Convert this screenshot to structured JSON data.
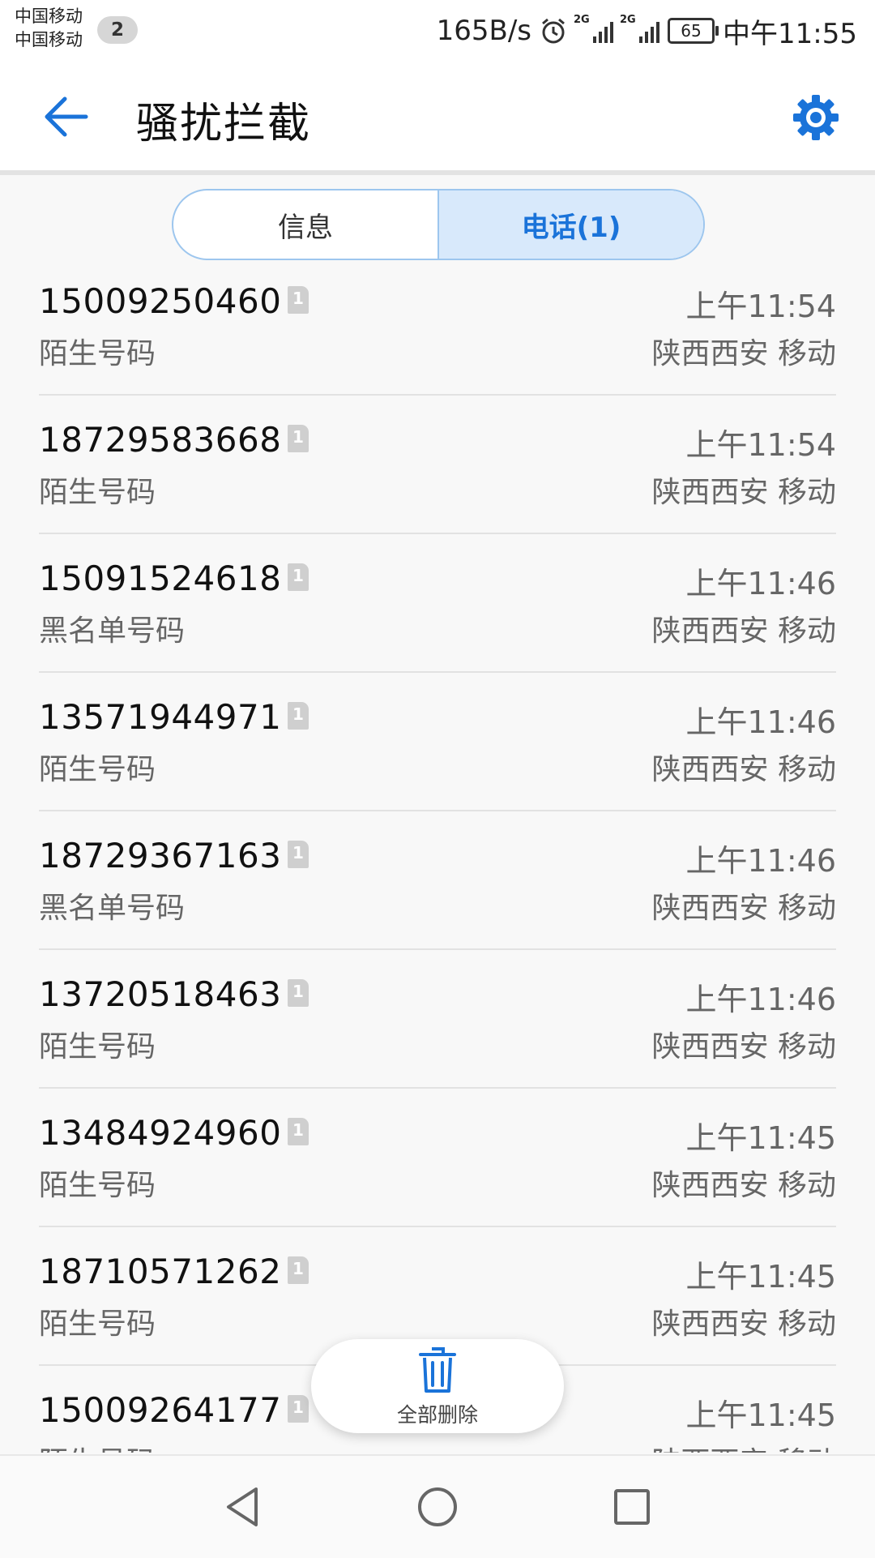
{
  "status_bar": {
    "carrier_1": "中国移动",
    "carrier_2": "中国移动",
    "sim_count": "2",
    "net_speed": "165B/s",
    "signal_1_label": "2G",
    "signal_2_label": "2G",
    "battery": "65",
    "time": "中午11:55"
  },
  "header": {
    "title": "骚扰拦截",
    "back_icon": "arrow-left-icon",
    "settings_icon": "gear-icon"
  },
  "tabs": [
    {
      "label": "信息",
      "active": false
    },
    {
      "label": "电话(1)",
      "active": true
    }
  ],
  "calls": [
    {
      "number": "15009250460",
      "type": "陌生号码",
      "time": "上午11:54",
      "location": "陕西西安 移动"
    },
    {
      "number": "18729583668",
      "type": "陌生号码",
      "time": "上午11:54",
      "location": "陕西西安 移动"
    },
    {
      "number": "15091524618",
      "type": "黑名单号码",
      "time": "上午11:46",
      "location": "陕西西安 移动"
    },
    {
      "number": "13571944971",
      "type": "陌生号码",
      "time": "上午11:46",
      "location": "陕西西安 移动"
    },
    {
      "number": "18729367163",
      "type": "黑名单号码",
      "time": "上午11:46",
      "location": "陕西西安 移动"
    },
    {
      "number": "13720518463",
      "type": "陌生号码",
      "time": "上午11:46",
      "location": "陕西西安 移动"
    },
    {
      "number": "13484924960",
      "type": "陌生号码",
      "time": "上午11:45",
      "location": "陕西西安 移动"
    },
    {
      "number": "18710571262",
      "type": "陌生号码",
      "time": "上午11:45",
      "location": "陕西西安 移动"
    },
    {
      "number": "15009264177",
      "type": "陌生号码",
      "time": "上午11:45",
      "location": "陕西西安 移动"
    }
  ],
  "delete_all": {
    "label": "全部删除",
    "icon": "trash-icon"
  },
  "navbar": {
    "back_icon": "triangle-back-icon",
    "home_icon": "circle-home-icon",
    "recents_icon": "square-recents-icon"
  },
  "colors": {
    "accent": "#1a73d9",
    "tab_active_bg": "#d8e9fb"
  }
}
